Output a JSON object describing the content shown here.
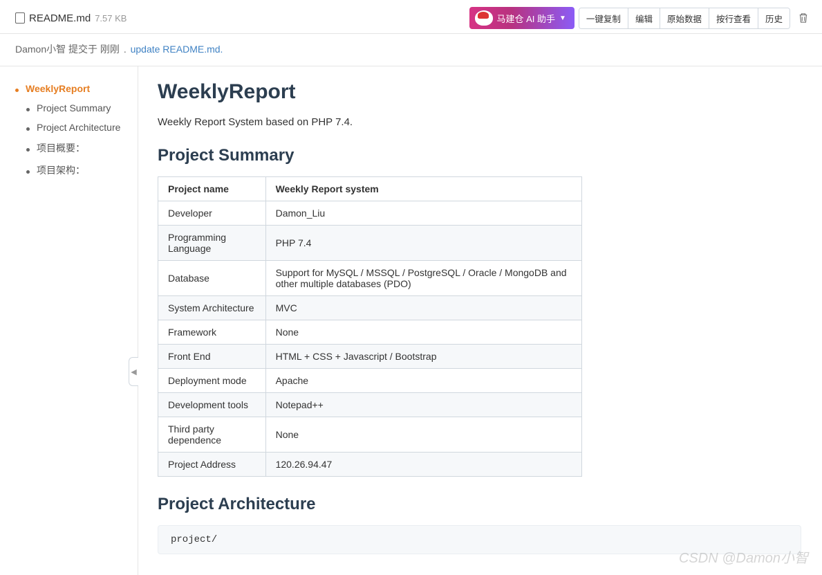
{
  "header": {
    "file_name": "README.md",
    "file_size": "7.57 KB",
    "ai_button": "马建仓 AI 助手",
    "actions": [
      "一键复制",
      "编辑",
      "原始数据",
      "按行查看",
      "历史"
    ]
  },
  "commit": {
    "author": "Damon小智",
    "submit_text": "提交于",
    "time": "刚刚",
    "separator": ".",
    "message": "update README.md.",
    "message_suffix": ""
  },
  "toc": [
    {
      "label": "WeeklyReport",
      "level": 1,
      "active": true
    },
    {
      "label": "Project Summary",
      "level": 2,
      "active": false
    },
    {
      "label": "Project Architecture",
      "level": 2,
      "active": false
    },
    {
      "label": "项目概要：",
      "level": 2,
      "active": false
    },
    {
      "label": "项目架构：",
      "level": 2,
      "active": false
    }
  ],
  "doc": {
    "title": "WeeklyReport",
    "intro": "Weekly Report System based on PHP 7.4.",
    "summary_heading": "Project Summary",
    "table_headers": [
      "Project name",
      "Weekly Report system"
    ],
    "table_rows": [
      {
        "k": "Developer",
        "v": "Damon_Liu"
      },
      {
        "k": "Programming Language",
        "v": "PHP 7.4"
      },
      {
        "k": "Database",
        "v": "Support for MySQL / MSSQL / PostgreSQL / Oracle / MongoDB and other multiple databases (PDO)"
      },
      {
        "k": "System Architecture",
        "v": "MVC"
      },
      {
        "k": "Framework",
        "v": "None"
      },
      {
        "k": "Front End",
        "v": "HTML + CSS + Javascript / Bootstrap"
      },
      {
        "k": "Deployment mode",
        "v": "Apache"
      },
      {
        "k": "Development tools",
        "v": "Notepad++"
      },
      {
        "k": "Third party dependence",
        "v": "None"
      },
      {
        "k": "Project Address",
        "v": "120.26.94.47"
      }
    ],
    "arch_heading": "Project Architecture",
    "code_line": "project/"
  },
  "watermark": "CSDN @Damon小智"
}
